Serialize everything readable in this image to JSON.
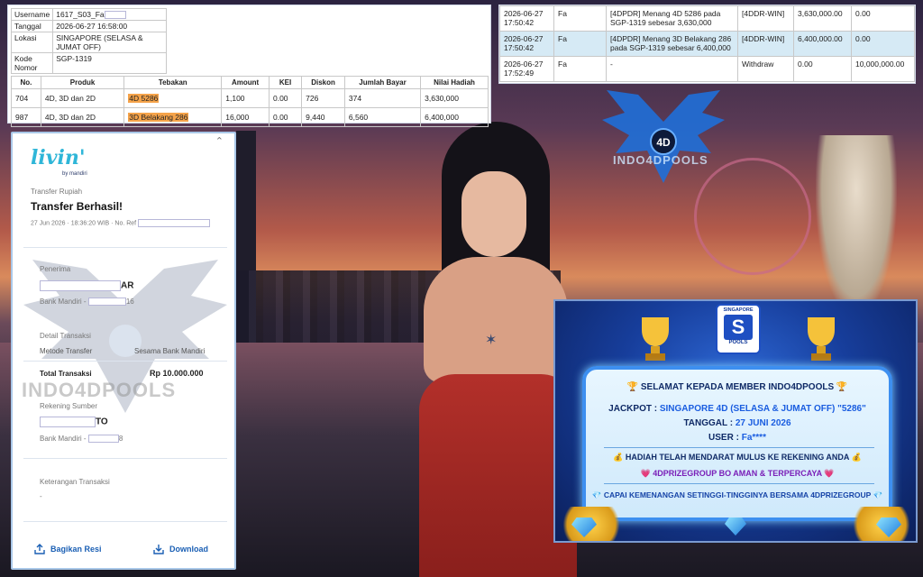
{
  "bet_info": {
    "rows": [
      {
        "label": "Username",
        "value": "1617_S03_Fa"
      },
      {
        "label": "Tanggal",
        "value": "2026-06-27 16:58:00"
      },
      {
        "label": "Lokasi",
        "value": "SINGAPORE (SELASA & JUMAT OFF)"
      },
      {
        "label": "Kode Nomor",
        "value": "SGP-1319"
      }
    ]
  },
  "bet_table": {
    "headers": [
      "No.",
      "Produk",
      "Tebakan",
      "Amount",
      "KEI",
      "Diskon",
      "Jumlah Bayar",
      "Nilai Hadiah"
    ],
    "rows": [
      [
        "704",
        "4D, 3D dan 2D",
        "4D 5286",
        "1,100",
        "0.00",
        "726",
        "374",
        "3,630,000"
      ],
      [
        "987",
        "4D, 3D dan 2D",
        "3D Belakang 286",
        "16,000",
        "0.00",
        "9,440",
        "6,560",
        "6,400,000"
      ]
    ]
  },
  "transactions": {
    "rows": [
      {
        "date": "2026-06-27",
        "time": "17:50:42",
        "user": "Fa",
        "desc": "[4DPDR] Menang 4D 5286 pada SGP-1319 sebesar 3,630,000",
        "type": "[4DDR-WIN]",
        "credit": "3,630,000.00",
        "debit": "0.00"
      },
      {
        "date": "2026-06-27",
        "time": "17:50:42",
        "user": "Fa",
        "desc": "[4DPDR] Menang 3D Belakang 286 pada SGP-1319 sebesar 6,400,000",
        "type": "[4DDR-WIN]",
        "credit": "6,400,000.00",
        "debit": "0.00"
      },
      {
        "date": "2026-06-27",
        "time": "17:52:49",
        "user": "Fa",
        "desc": "-",
        "type": "Withdraw",
        "credit": "0.00",
        "debit": "10,000,000.00"
      }
    ]
  },
  "receipt": {
    "brand": "livin'",
    "brand_sub": "by mandiri",
    "section": "Transfer Rupiah",
    "title": "Transfer Berhasil!",
    "date_line": "27 Jun 2026 · 18:36:20 WIB · No. Ref",
    "penerima_label": "Penerima",
    "penerima_suffix": "AR",
    "bank_penerima": "Bank Mandiri -",
    "bank_penerima_suffix": "16",
    "detail_label": "Detail Transaksi",
    "metode_label": "Metode Transfer",
    "metode_value": "Sesama Bank Mandiri",
    "total_label": "Total Transaksi",
    "total_value": "Rp 10.000.000",
    "sumber_label": "Rekening Sumber",
    "sumber_suffix": "TO",
    "bank_sumber": "Bank Mandiri -",
    "bank_sumber_suffix": "8",
    "keterangan_label": "Keterangan Transaksi",
    "keterangan_value": "-",
    "share_label": "Bagikan Resi",
    "download_label": "Download",
    "watermark": "INDO4DPOOLS"
  },
  "logo": {
    "badge": "4D",
    "text": "INDO4DPOOLS"
  },
  "banner": {
    "logo_top": "SINGAPORE",
    "logo_letter": "S",
    "logo_bottom": "POOLS",
    "title": "🏆 SELAMAT KEPADA MEMBER INDO4DPOOLS 🏆",
    "jackpot_label": "JACKPOT :",
    "jackpot_value": "SINGAPORE 4D (SELASA & JUMAT OFF) \"5286\"",
    "tanggal_label": "TANGGAL :",
    "tanggal_value": "27 JUNI 2026",
    "user_label": "USER :",
    "user_value": "Fa****",
    "hadiah": "💰 HADIAH TELAH MENDARAT MULUS KE REKENING ANDA 💰",
    "group": "💗 4DPRIZEGROUP BO AMAN & TERPERCAYA 💗",
    "capai": "💎 CAPAI KEMENANGAN SETINGGI-TINGGINYA BERSAMA 4DPRIZEGROUP 💎"
  }
}
